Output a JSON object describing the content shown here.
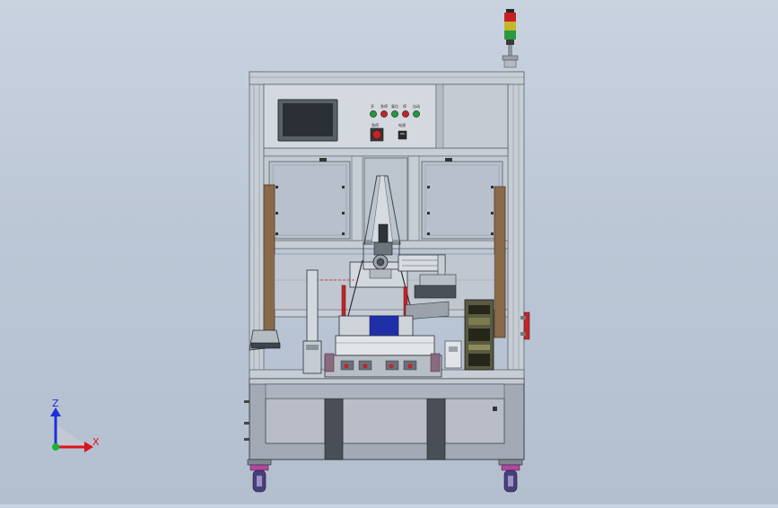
{
  "triad": {
    "z_label": "Z",
    "x_label": "X"
  },
  "control_panel": {
    "button_labels": [
      "开",
      "急停",
      "复位",
      "停",
      "自动"
    ],
    "lower_labels": [
      "急停",
      "电源"
    ]
  },
  "colors": {
    "frame": "#c7cdd4",
    "frame_dark": "#7f8891",
    "base_cabinet": "#a3a9b5",
    "base_panel": "#b8bdc8",
    "screen": "#2b2f36",
    "accent_blue": "#1f2fa8",
    "accent_red": "#c0242a",
    "accent_green": "#1f9a3a",
    "wood_post": "#8a6a4a",
    "axis_z": "#1c2fd8",
    "axis_x": "#d8141c",
    "axis_y": "#12b53a",
    "caster_wheel": "#4a3f7a",
    "signal_red": "#c91f24",
    "signal_yellow": "#c7b52b",
    "signal_green": "#2a9a3f"
  }
}
